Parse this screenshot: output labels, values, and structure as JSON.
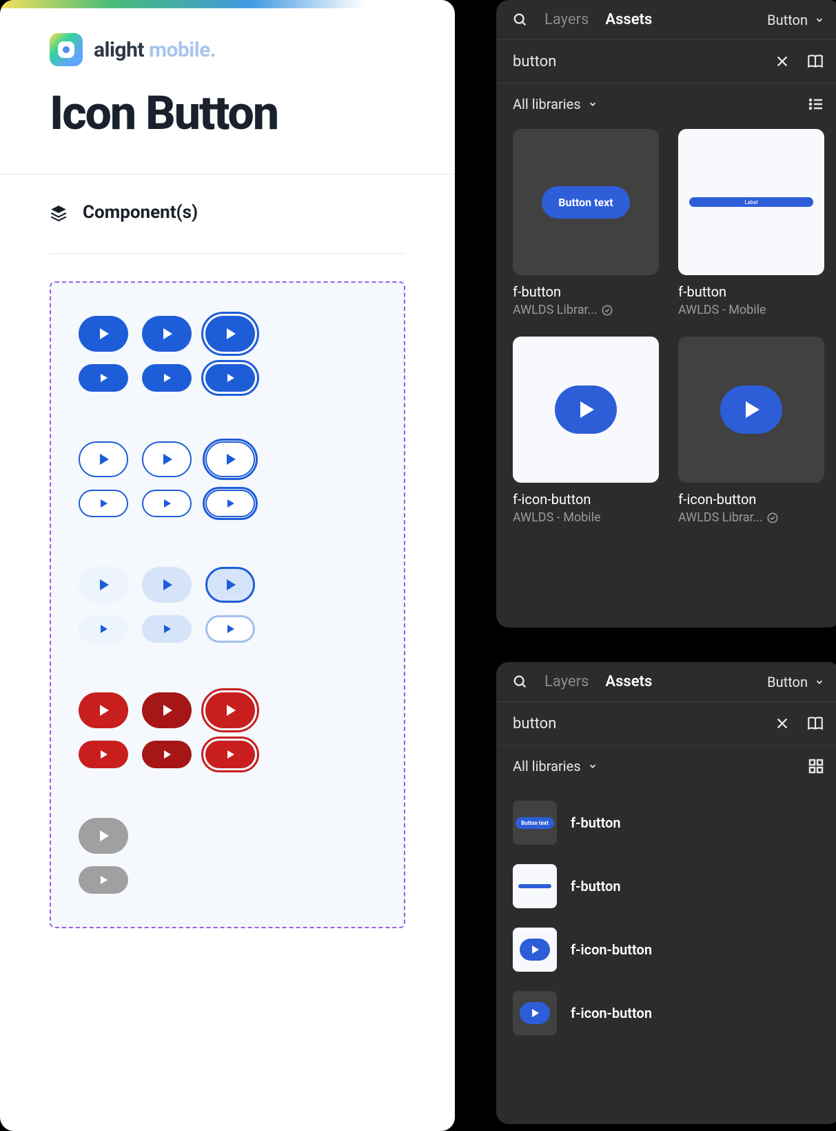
{
  "doc": {
    "brand_word1": "alight",
    "brand_word2": " mobile",
    "brand_dot": ".",
    "title": "Icon Button",
    "section": "Component(s)"
  },
  "panels": {
    "tab_layers": "Layers",
    "tab_assets": "Assets",
    "filter_dropdown": "Button",
    "search_value": "button",
    "library_filter": "All libraries"
  },
  "grid_assets": [
    {
      "name": "f-button",
      "lib": "AWLDS Librar...",
      "verified": true,
      "thumb": "pill",
      "bg": "dark",
      "pill_label": "Button text"
    },
    {
      "name": "f-button",
      "lib": "AWLDS - Mobile",
      "verified": false,
      "thumb": "bar",
      "bg": "light",
      "bar_label": "Label"
    },
    {
      "name": "f-icon-button",
      "lib": "AWLDS - Mobile",
      "verified": false,
      "thumb": "iconplay",
      "bg": "light"
    },
    {
      "name": "f-icon-button",
      "lib": "AWLDS Librar...",
      "verified": true,
      "thumb": "iconplay",
      "bg": "dark"
    }
  ],
  "list_assets": [
    {
      "name": "f-button",
      "thumb": "pill",
      "bg": "dark",
      "pill_label": "Button text"
    },
    {
      "name": "f-button",
      "thumb": "bar",
      "bg": "light"
    },
    {
      "name": "f-icon-button",
      "thumb": "iconplay",
      "bg": "light"
    },
    {
      "name": "f-icon-button",
      "thumb": "iconplay",
      "bg": "dark"
    }
  ],
  "colors": {
    "primary": "#1e5dd8",
    "danger": "#c81e1e",
    "disabled": "#a0a0a0",
    "soft": "#d6e4fa"
  }
}
